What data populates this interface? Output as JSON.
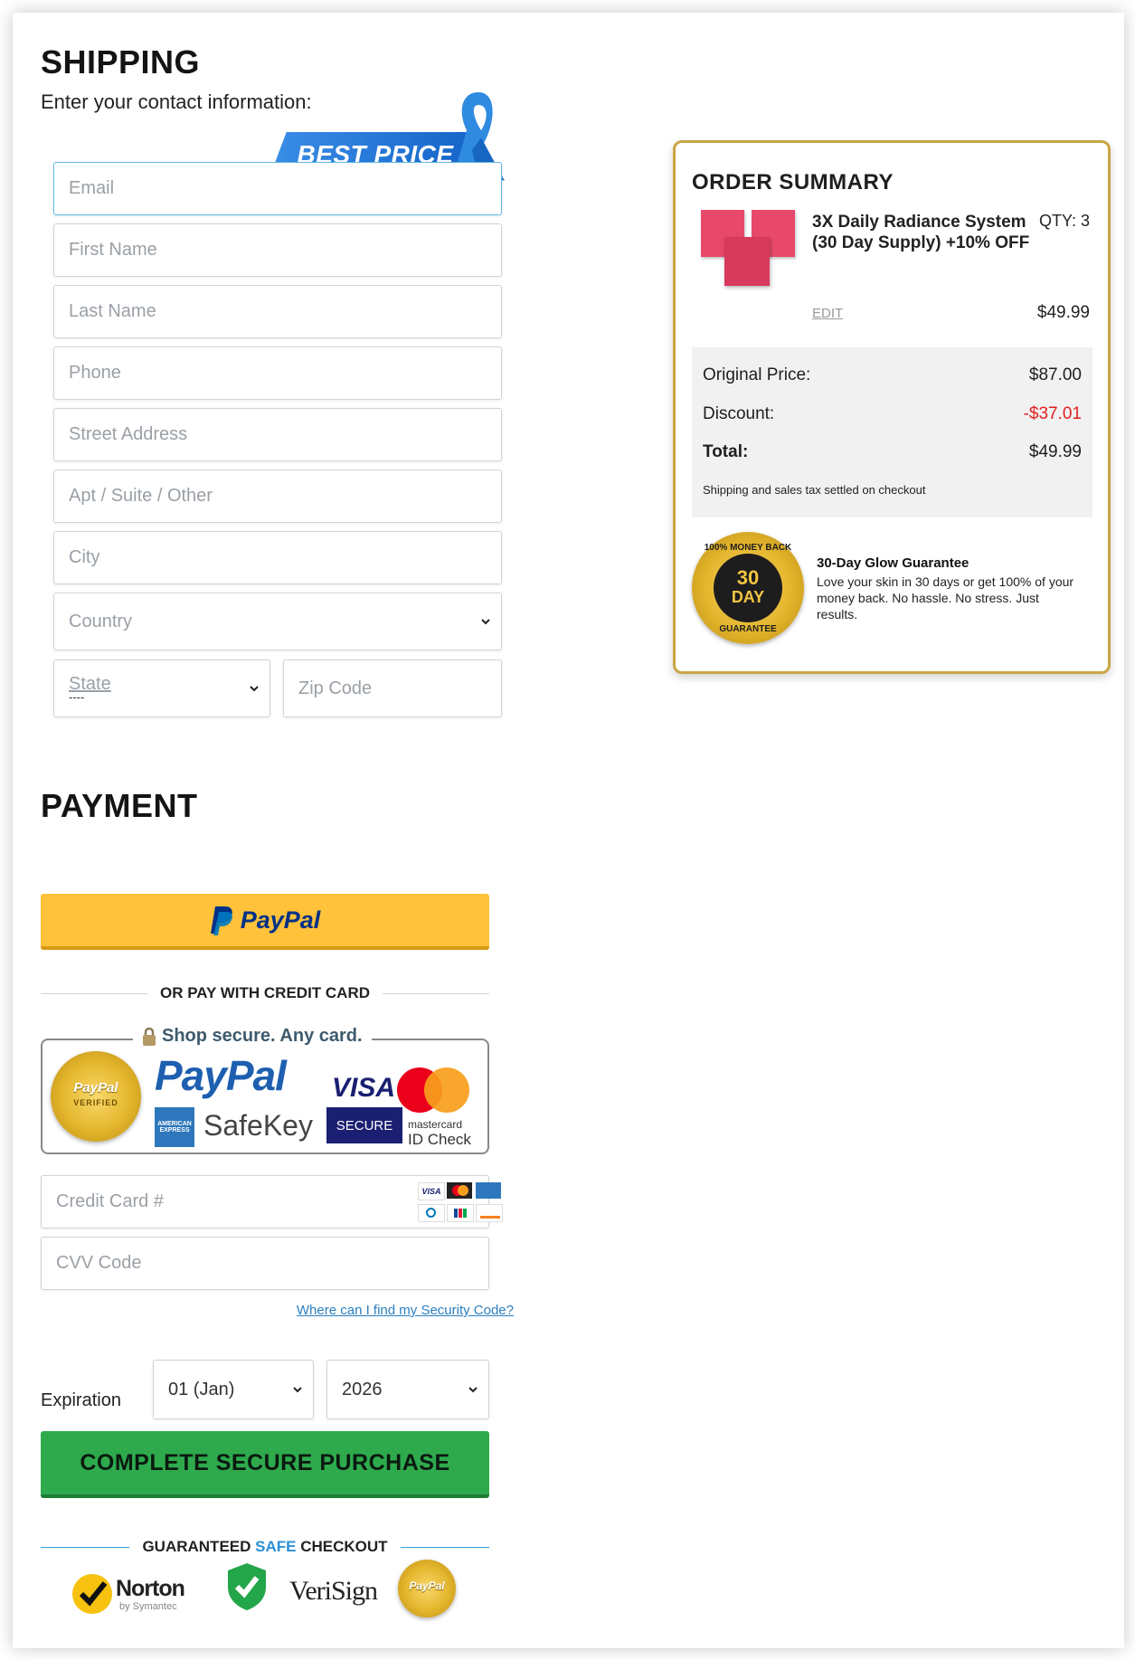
{
  "shipping": {
    "title": "SHIPPING",
    "subtitle": "Enter your contact information:",
    "badge": "BEST PRICE",
    "fields": {
      "email": "Email",
      "first_name": "First Name",
      "last_name": "Last Name",
      "phone": "Phone",
      "street": "Street Address",
      "apt": "Apt / Suite / Other",
      "city": "City",
      "country": "Country",
      "state": "State",
      "state_sub": "----",
      "zip": "Zip Code"
    }
  },
  "payment": {
    "title": "PAYMENT",
    "paypal_label": "PayPal",
    "or_text": "OR PAY WITH CREDIT CARD",
    "secure_box": {
      "headline": "Shop secure. Any card.",
      "paypal_verified": "PayPal",
      "verified_text": "VERIFIED",
      "paypal_logo": "PayPal",
      "visa": "VISA",
      "amex": "AMERICAN EXPRESS",
      "safekey": "SafeKey",
      "secure": "SECURE",
      "mastercard": "mastercard",
      "id_check": "ID Check"
    },
    "card_placeholder": "Credit Card #",
    "cvv_placeholder": "CVV Code",
    "security_link": "Where can I find my Security Code?",
    "expiration_label": "Expiration",
    "month_value": "01 (Jan)",
    "year_value": "2026",
    "cta": "COMPLETE SECURE PURCHASE",
    "guaranteed": {
      "pre": "GUARANTEED",
      "mid": "SAFE",
      "post": "CHECKOUT"
    },
    "trust": {
      "norton": "Norton",
      "norton_sub": "by Symantec",
      "verisign": "VeriSign",
      "paypal_seal": "PayPal"
    }
  },
  "summary": {
    "title": "ORDER SUMMARY",
    "product_name": "3X Daily Radiance System (30 Day Supply) +10% OFF",
    "qty": "QTY: 3",
    "edit": "EDIT",
    "item_price": "$49.99",
    "original_label": "Original Price:",
    "original_value": "$87.00",
    "discount_label": "Discount:",
    "discount_value": "-$37.01",
    "total_label": "Total:",
    "total_value": "$49.99",
    "note": "Shipping and sales tax settled on checkout",
    "guarantee_title": "30-Day Glow Guarantee",
    "guarantee_text": "Love your skin in 30 days or get 100% of your money back. No hassle. No stress. Just results.",
    "seal_top": "100% MONEY BACK",
    "seal_num": "30",
    "seal_day": "DAY",
    "seal_bottom": "GUARANTEE"
  },
  "colors": {
    "paypal_yellow": "#ffc23a",
    "cta_green": "#2eaa4d",
    "gold_border": "#c9a544",
    "discount_red": "#e02020",
    "link_blue": "#2a7fbf"
  }
}
